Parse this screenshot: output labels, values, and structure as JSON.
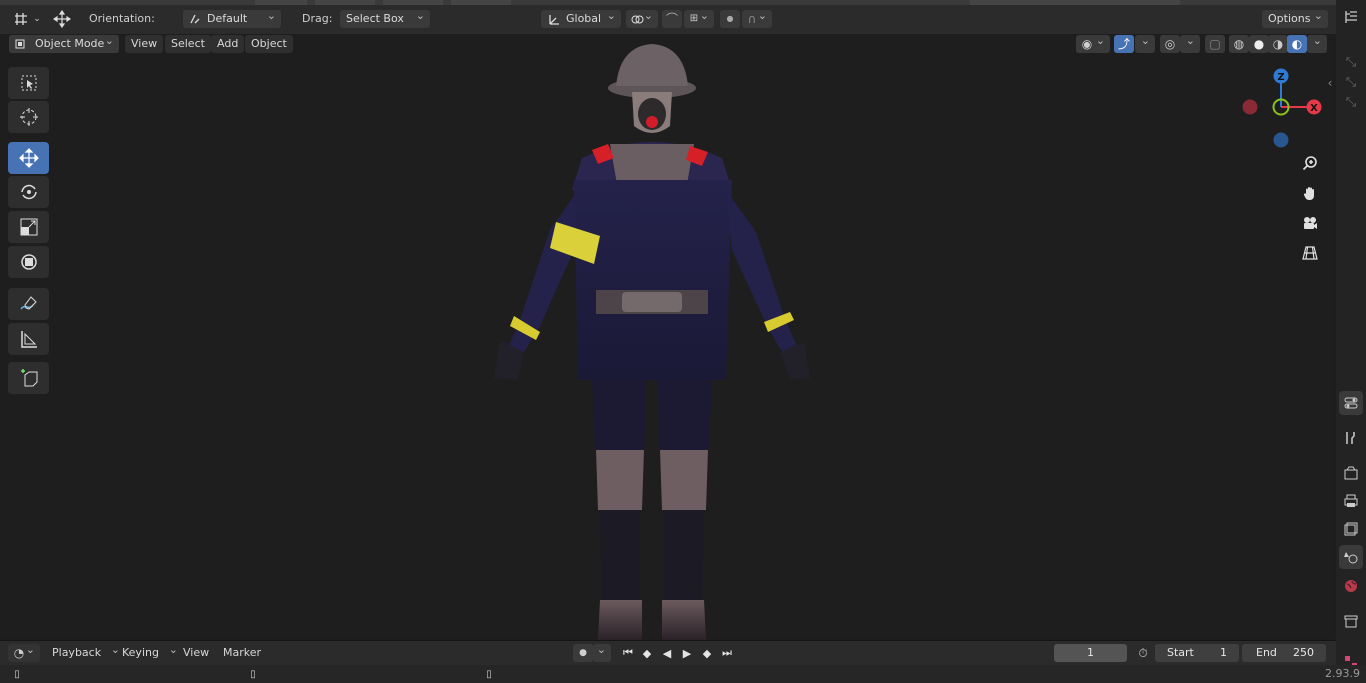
{
  "header": {
    "orientation_label": "Orientation:",
    "orientation_value": "Default",
    "drag_label": "Drag:",
    "drag_value": "Select Box",
    "transform_space": "Global",
    "options_label": "Options"
  },
  "viewport_header": {
    "mode": "Object Mode",
    "menus": [
      "View",
      "Select",
      "Add",
      "Object"
    ]
  },
  "toolbar": {
    "tools": [
      {
        "name": "select-box-tool",
        "icon": "select-box-icon",
        "active": false
      },
      {
        "name": "cursor-tool",
        "icon": "cursor-icon",
        "active": false
      },
      {
        "name": "move-tool",
        "icon": "move-icon",
        "active": true
      },
      {
        "name": "rotate-tool",
        "icon": "rotate-icon",
        "active": false
      },
      {
        "name": "scale-tool",
        "icon": "scale-icon",
        "active": false
      },
      {
        "name": "transform-tool",
        "icon": "transform-icon",
        "active": false
      },
      {
        "name": "annotate-tool",
        "icon": "annotate-icon",
        "active": false
      },
      {
        "name": "measure-tool",
        "icon": "measure-icon",
        "active": false
      },
      {
        "name": "add-cube-tool",
        "icon": "add-cube-icon",
        "active": false
      }
    ]
  },
  "gizmo": {
    "z_label": "Z",
    "x_label": "X",
    "colors": {
      "x": "#e5394a",
      "y": "#8bc21f",
      "z": "#2e7bd6"
    }
  },
  "timeline": {
    "menus": [
      "Playback",
      "Keying",
      "View",
      "Marker"
    ],
    "current_frame": "1",
    "start_label": "Start",
    "start_value": "1",
    "end_label": "End",
    "end_value": "250"
  },
  "status": {
    "version": "2.93.9"
  },
  "colors": {
    "accent": "#4772b3",
    "bg": "#1e1e1e"
  }
}
